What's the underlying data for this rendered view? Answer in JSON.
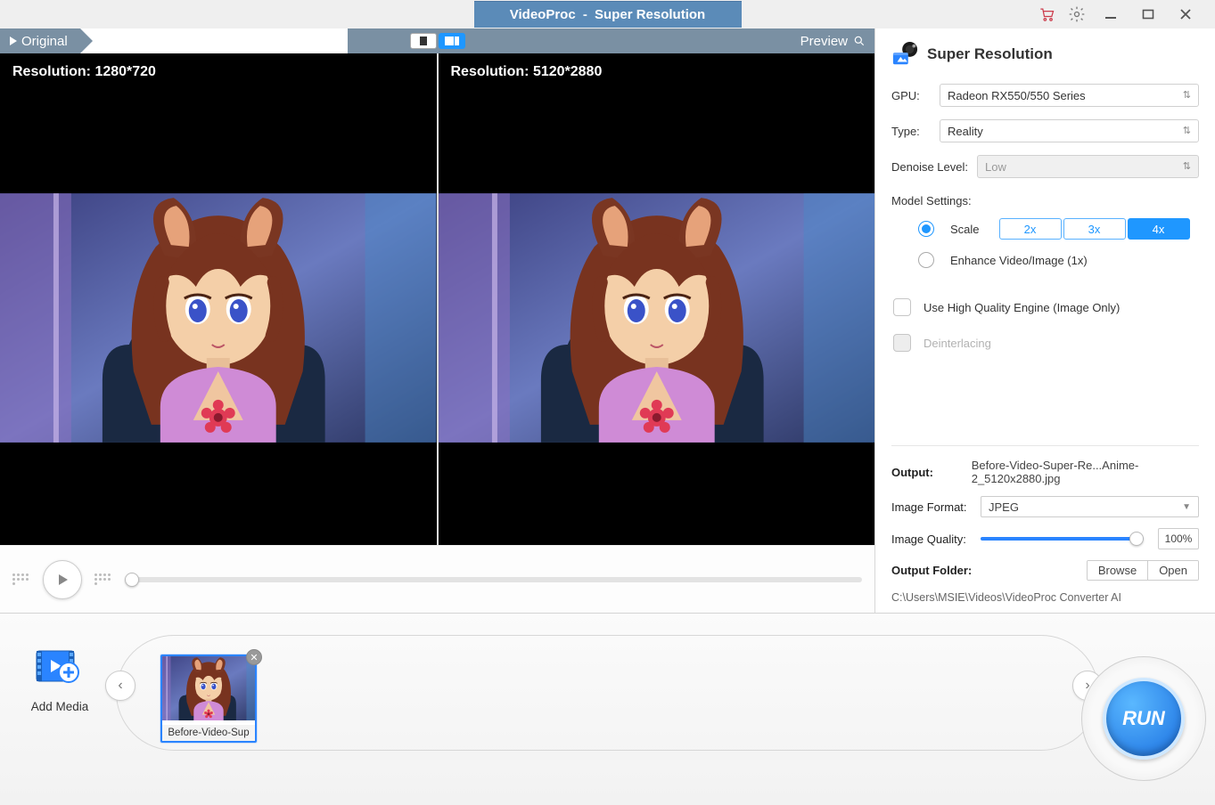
{
  "titlebar": {
    "app": "VideoProc",
    "page": "Super Resolution"
  },
  "preview": {
    "original_label": "Original",
    "preview_label": "Preview",
    "left_res": "Resolution: 1280*720",
    "right_res": "Resolution: 5120*2880"
  },
  "side": {
    "title": "Super Resolution",
    "gpu_label": "GPU:",
    "gpu_value": "Radeon RX550/550 Series",
    "type_label": "Type:",
    "type_value": "Reality",
    "denoise_label": "Denoise Level:",
    "denoise_value": "Low",
    "model_settings": "Model Settings:",
    "scale_label": "Scale",
    "scales": {
      "x2": "2x",
      "x3": "3x",
      "x4": "4x"
    },
    "enhance_label": "Enhance Video/Image (1x)",
    "hq_label": "Use High Quality Engine (Image Only)",
    "deint_label": "Deinterlacing"
  },
  "output": {
    "out_label": "Output:",
    "out_value": "Before-Video-Super-Re...Anime-2_5120x2880.jpg",
    "format_label": "Image Format:",
    "format_value": "JPEG",
    "quality_label": "Image Quality:",
    "quality_value": "100%",
    "folder_label": "Output Folder:",
    "browse": "Browse",
    "open": "Open",
    "path": "C:\\Users\\MSIE\\Videos\\VideoProc Converter AI"
  },
  "bottom": {
    "add_media": "Add Media",
    "thumb_name": "Before-Video-Sup",
    "run": "RUN"
  }
}
